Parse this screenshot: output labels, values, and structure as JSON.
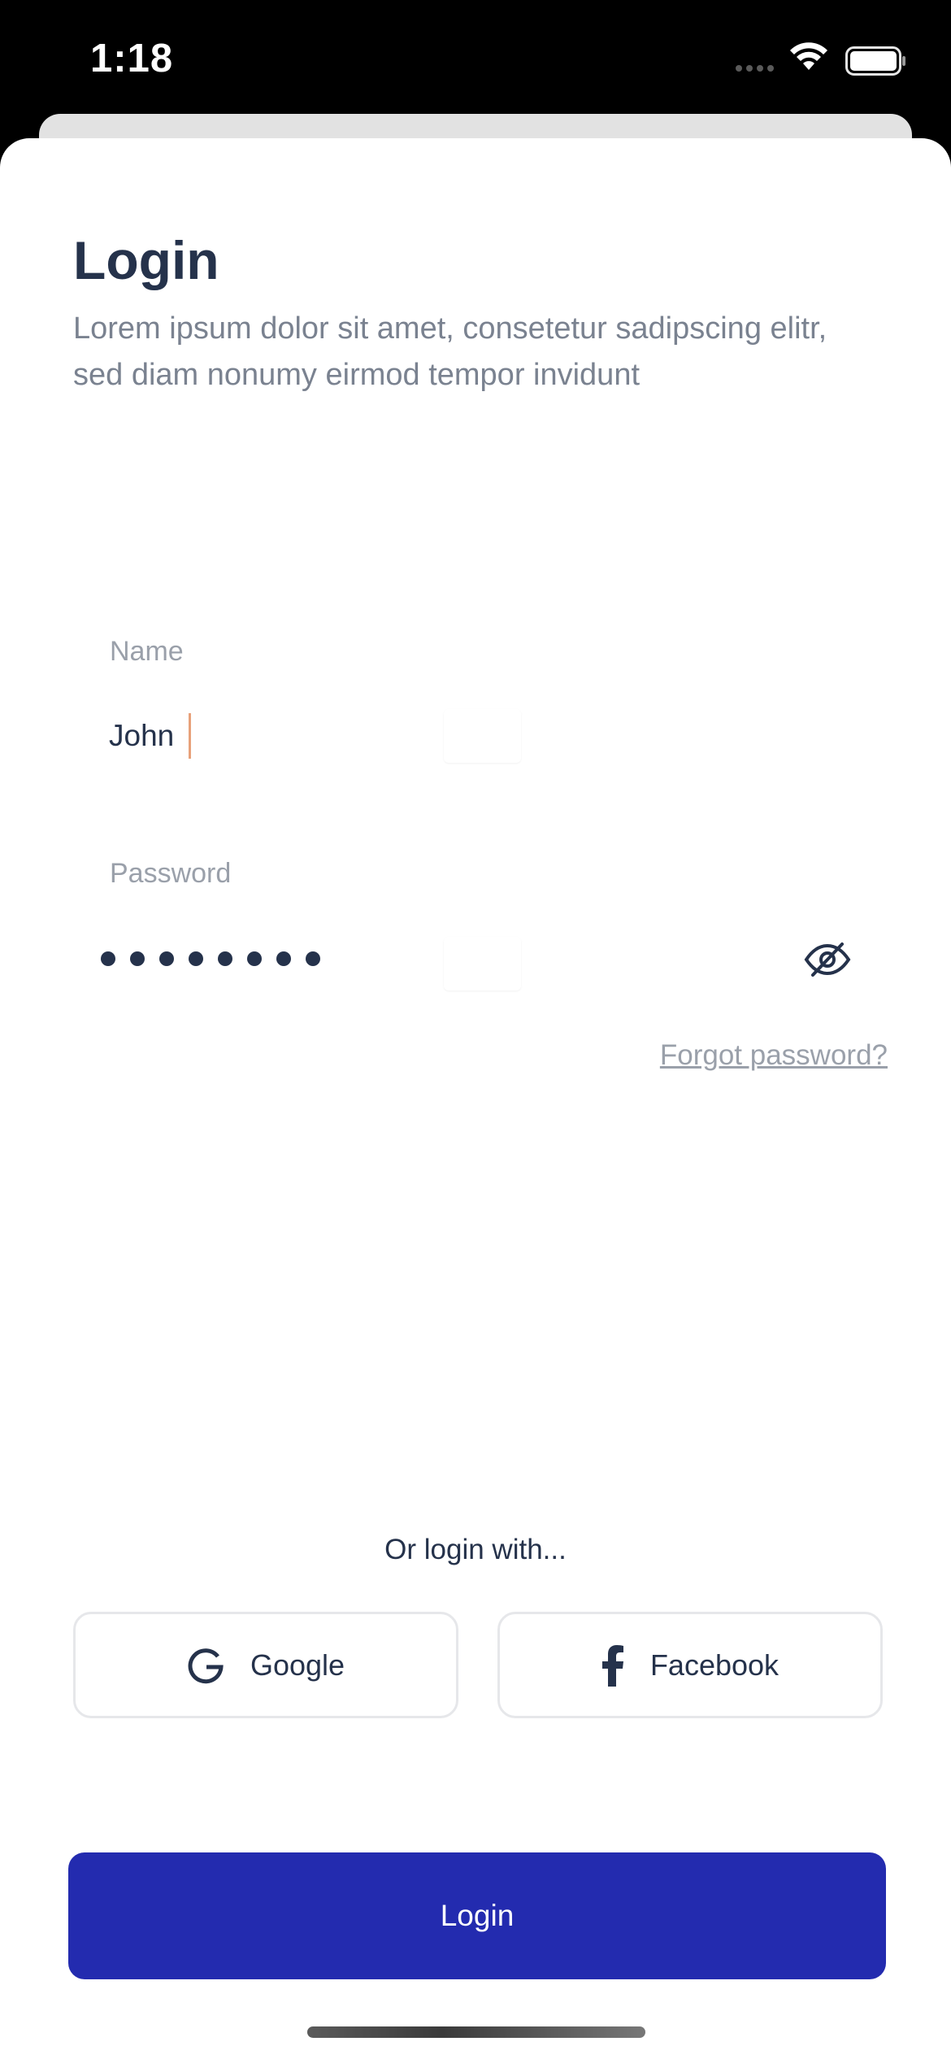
{
  "status_bar": {
    "time": "1:18"
  },
  "header": {
    "title": "Login",
    "subtitle": "Lorem ipsum dolor sit amet, consetetur sadipscing elitr, sed diam nonumy eirmod tempor invidunt"
  },
  "form": {
    "name_label": "Name",
    "name_value": "John",
    "password_label": "Password",
    "password_masked": "••••••••",
    "password_visibility_icon": "eye-off-icon",
    "forgot_label": "Forgot password?"
  },
  "social": {
    "heading": "Or login with...",
    "buttons": [
      {
        "label": "Google",
        "icon": "google-icon"
      },
      {
        "label": "Facebook",
        "icon": "facebook-icon"
      }
    ]
  },
  "primary_action": {
    "label": "Login",
    "color": "#232baf"
  },
  "colors": {
    "title": "#25324b",
    "subtitle": "#7a8290",
    "label": "#9aa0aa",
    "caret": "#e8a17a"
  }
}
